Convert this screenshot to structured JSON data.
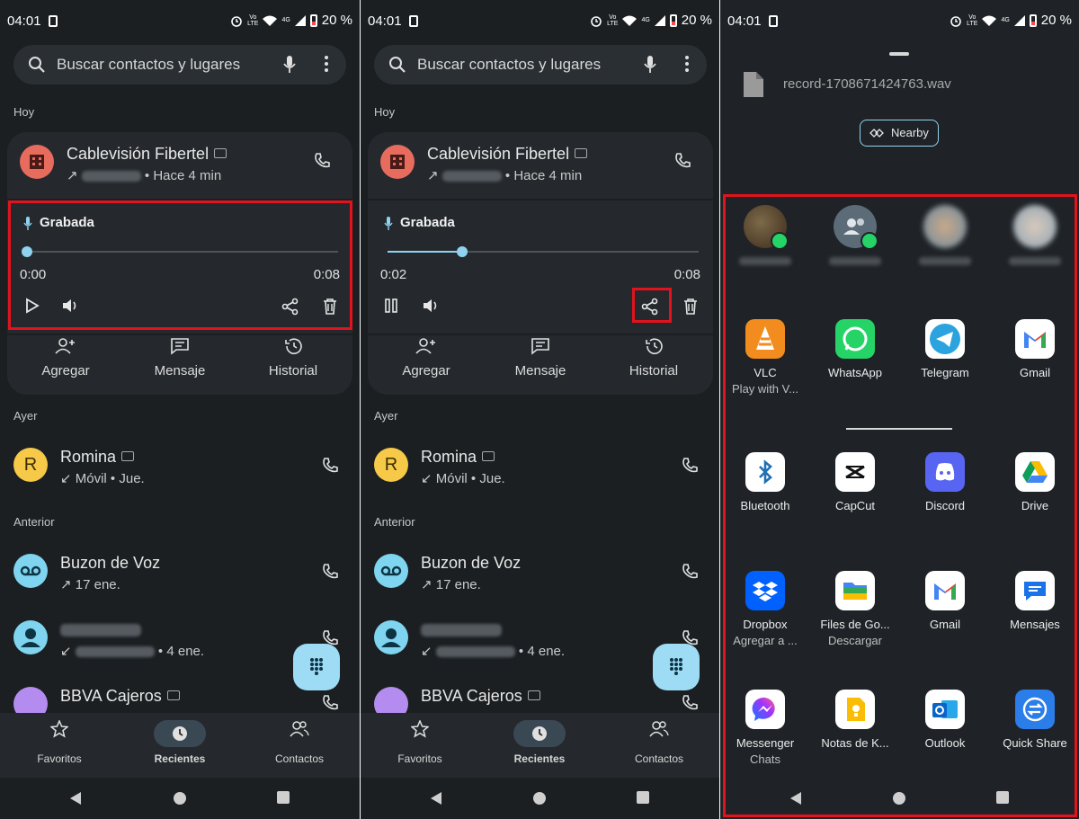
{
  "status": {
    "time": "04:01",
    "battery": "20 %",
    "network": "4G",
    "volte": "VoLTE"
  },
  "search": {
    "placeholder": "Buscar contactos y lugares"
  },
  "sections": {
    "today": "Hoy",
    "yesterday": "Ayer",
    "earlier": "Anterior"
  },
  "calls": {
    "fibertel": {
      "name": "Cablevisión Fibertel",
      "when": "Hace 4 min",
      "avatar_color": "#e86c5e"
    },
    "romina": {
      "name": "Romina",
      "initial": "R",
      "line": "Móvil",
      "when": "Jue.",
      "avatar_color": "#f7c948"
    },
    "buzon": {
      "name": "Buzon de Voz",
      "when": "17 ene.",
      "avatar_color": "#7fd4f0"
    },
    "unknown": {
      "when": "4 ene.",
      "avatar_color": "#7fd4f0"
    },
    "bbva": {
      "name": "BBVA Cajeros",
      "avatar_color": "#b48cf0"
    }
  },
  "recording": {
    "label": "Grabada",
    "panel1": {
      "elapsed": "0:00",
      "total": "0:08",
      "progress": 0.0
    },
    "panel2": {
      "elapsed": "0:02",
      "total": "0:08",
      "progress": 0.24
    }
  },
  "actions": {
    "add": "Agregar",
    "message": "Mensaje",
    "history": "Historial"
  },
  "bottom_nav": {
    "favorites": "Favoritos",
    "recents": "Recientes",
    "contacts": "Contactos"
  },
  "share": {
    "file_name": "record-1708671424763.wav",
    "nearby_label": "Nearby",
    "apps": [
      {
        "name": "VLC",
        "sub": "Play with V..."
      },
      {
        "name": "WhatsApp",
        "sub": ""
      },
      {
        "name": "Telegram",
        "sub": ""
      },
      {
        "name": "Gmail",
        "sub": ""
      },
      {
        "name": "Bluetooth",
        "sub": ""
      },
      {
        "name": "CapCut",
        "sub": ""
      },
      {
        "name": "Discord",
        "sub": ""
      },
      {
        "name": "Drive",
        "sub": ""
      },
      {
        "name": "Dropbox",
        "sub": "Agregar a ..."
      },
      {
        "name": "Files de Go...",
        "sub": "Descargar"
      },
      {
        "name": "Gmail",
        "sub": ""
      },
      {
        "name": "Mensajes",
        "sub": ""
      },
      {
        "name": "Messenger",
        "sub": "Chats"
      },
      {
        "name": "Notas de K...",
        "sub": ""
      },
      {
        "name": "Outlook",
        "sub": ""
      },
      {
        "name": "Quick Share",
        "sub": ""
      }
    ]
  },
  "colors": {
    "highlight": "#e1131c",
    "accent": "#8fd3f0",
    "background": "#1b1f22"
  }
}
